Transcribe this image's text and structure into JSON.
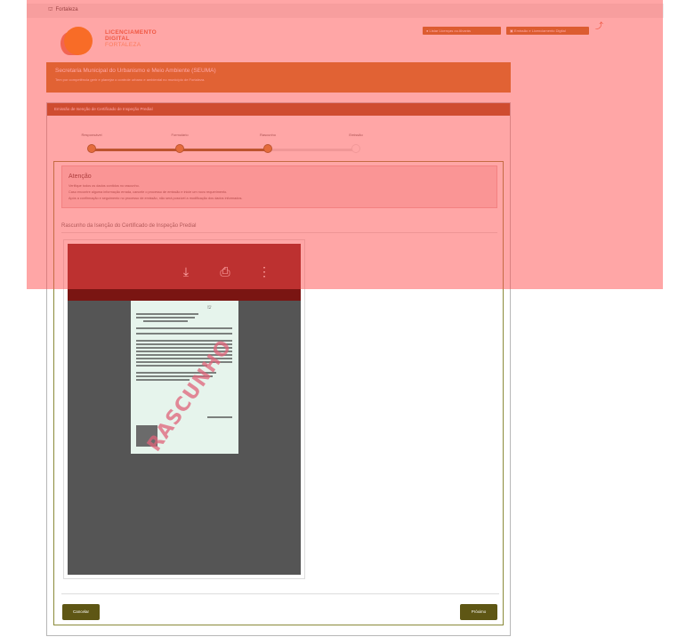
{
  "topbar": {
    "logo_label": "Fortaleza"
  },
  "brand": {
    "line1": "LICENCIAMENTO",
    "line2": "DIGITAL",
    "line3": "FORTALEZA"
  },
  "header_buttons": {
    "btn1": "Listar Licenças ou Alvarás",
    "btn2": "Emissão e Licenciamento Digital"
  },
  "secretaria": {
    "title": "Secretaria Municipal do Urbanismo e Meio Ambiente (SEUMA)",
    "subtitle": "Tem por competência gerir e planejar o controle urbano e ambiental no município de Fortaleza."
  },
  "card": {
    "header": "Emissão de Isenção de Certificado de Inspeção Predial"
  },
  "stepper": {
    "steps": [
      {
        "label": "Responsável",
        "done": true
      },
      {
        "label": "Formulário",
        "done": true
      },
      {
        "label": "Rascunho",
        "done": true
      },
      {
        "label": "Emissão",
        "done": false
      }
    ]
  },
  "alert": {
    "title": "Atenção",
    "lines": [
      "Verifique todos os dados contidos no rascunho.",
      "Caso encontre alguma informação errada, cancele o processo de emissão e inicie um novo requerimento.",
      "Após a confirmação e seguimento no processo de emissão, não será possível a modificação dos dados informados."
    ]
  },
  "section": {
    "title": "Rascunho da Isenção do Certificado de Inspeção Predial"
  },
  "viewer": {
    "icons": [
      "download-icon",
      "print-icon",
      "more-vert-icon"
    ],
    "stamp_text": "RASCUNHO"
  },
  "buttons": {
    "cancel": "Cancelar",
    "next": "Próximo"
  },
  "colors": {
    "accent_orange": "#c3761b",
    "card_header": "#9e4a12",
    "button": "#5e5614",
    "overlay": "#ff4e4e"
  }
}
